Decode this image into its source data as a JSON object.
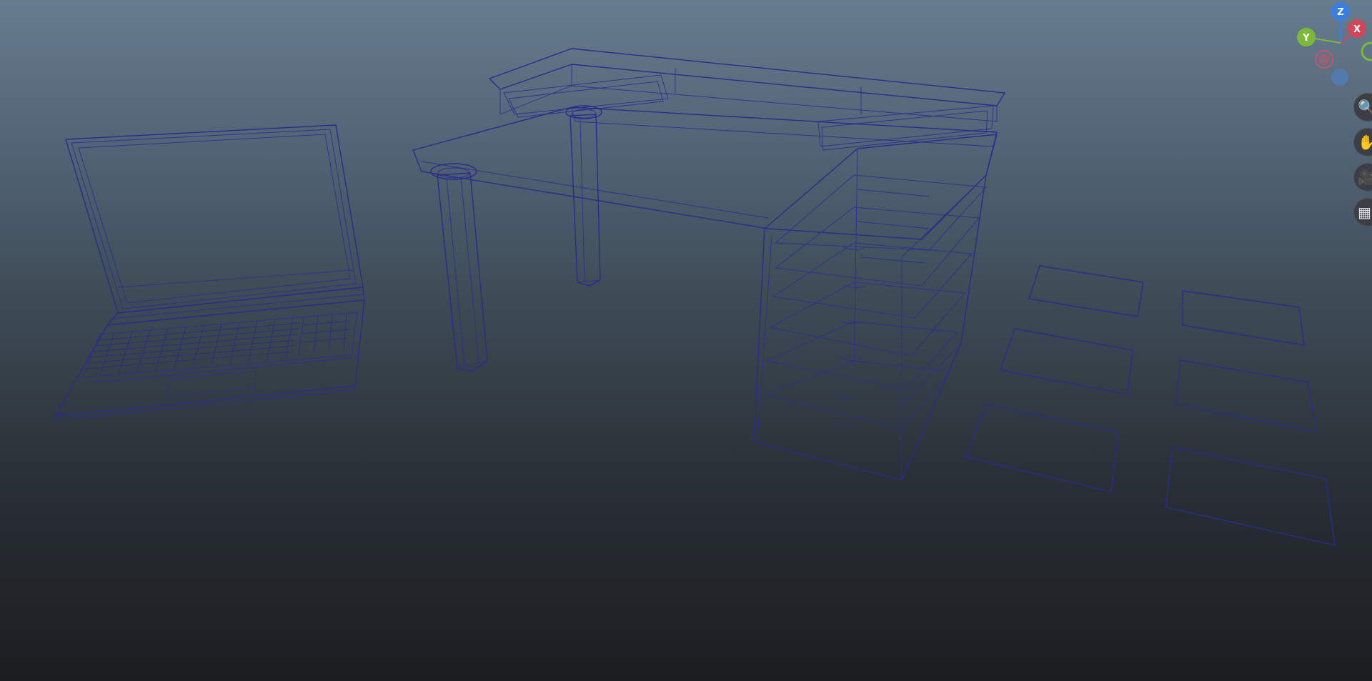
{
  "viewport": {
    "background_top": "#687c8f",
    "background_bottom": "#1b1d20",
    "wireframe_color": "#2a2c8c",
    "objects": [
      "laptop",
      "desk",
      "drawer-cabinet",
      "floor-tiles"
    ]
  },
  "view_cube": {
    "z_label": "Z",
    "x_label": "X",
    "y_label": "Y",
    "z_color": "#3a7fe0",
    "x_color": "#d0465b",
    "y_color": "#7cb83a",
    "neg_x_color": "#c2566a",
    "neg_z_color": "#4f7fbf"
  },
  "nav_tools": [
    {
      "icon": "zoom-icon",
      "glyph": "🔍"
    },
    {
      "icon": "pan-hand-icon",
      "glyph": "✋"
    },
    {
      "icon": "orbit-camera-icon",
      "glyph": "🎥"
    },
    {
      "icon": "perspective-grid-icon",
      "glyph": "▦"
    }
  ]
}
